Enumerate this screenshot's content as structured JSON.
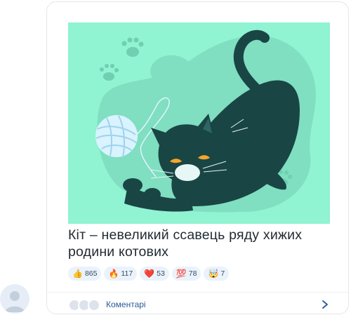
{
  "post": {
    "title": "Кіт – невеликий ссавець ряду хижих родини котових",
    "image_alt": "cat-playing-with-yarn-illustration"
  },
  "reactions": [
    {
      "icon": "thumbs-up-icon",
      "emoji": "👍",
      "count": "865"
    },
    {
      "icon": "fire-icon",
      "emoji": "🔥",
      "count": "117"
    },
    {
      "icon": "heart-icon",
      "emoji": "❤️",
      "count": "53"
    },
    {
      "icon": "hundred-icon",
      "emoji": "💯",
      "count": "78"
    },
    {
      "icon": "exploding-head-icon",
      "emoji": "🤯",
      "count": "7"
    }
  ],
  "footer": {
    "comments_label": "Коментарі"
  },
  "colors": {
    "illustration_bg": "#90f3d2",
    "cat": "#1a4545",
    "accent": "#2a5a96"
  }
}
